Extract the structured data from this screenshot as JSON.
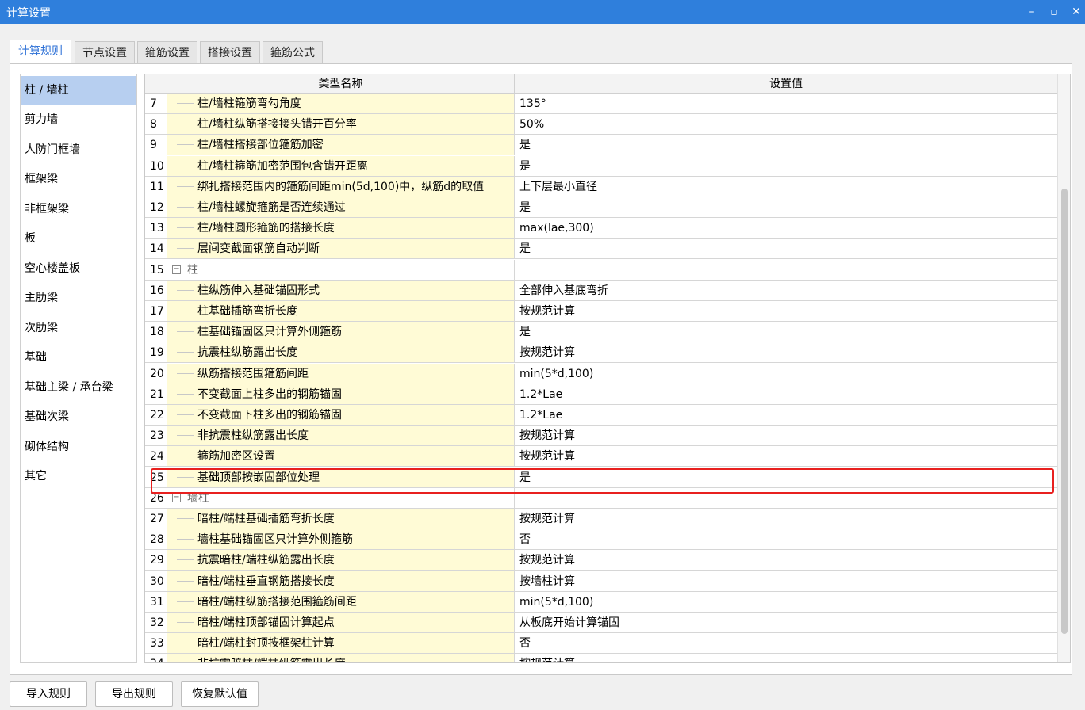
{
  "window": {
    "title": "计算设置",
    "minimize": "–",
    "maximize": "▫",
    "close": "✕"
  },
  "tabs": [
    "计算规则",
    "节点设置",
    "箍筋设置",
    "搭接设置",
    "箍筋公式"
  ],
  "sidebar": [
    "柱 / 墙柱",
    "剪力墙",
    "人防门框墙",
    "框架梁",
    "非框架梁",
    "板",
    "空心楼盖板",
    "主肋梁",
    "次肋梁",
    "基础",
    "基础主梁 / 承台梁",
    "基础次梁",
    "砌体结构",
    "其它"
  ],
  "grid": {
    "headers": [
      "类型名称",
      "设置值"
    ],
    "rows": [
      {
        "n": "7",
        "name": "柱/墙柱箍筋弯勾角度",
        "value": "135°"
      },
      {
        "n": "8",
        "name": "柱/墙柱纵筋搭接接头错开百分率",
        "value": "50%"
      },
      {
        "n": "9",
        "name": "柱/墙柱搭接部位箍筋加密",
        "value": "是"
      },
      {
        "n": "10",
        "name": "柱/墙柱箍筋加密范围包含错开距离",
        "value": "是"
      },
      {
        "n": "11",
        "name": "绑扎搭接范围内的箍筋间距min(5d,100)中，纵筋d的取值",
        "value": "上下层最小直径"
      },
      {
        "n": "12",
        "name": "柱/墙柱螺旋箍筋是否连续通过",
        "value": "是"
      },
      {
        "n": "13",
        "name": "柱/墙柱圆形箍筋的搭接长度",
        "value": "max(lae,300)"
      },
      {
        "n": "14",
        "name": "层间变截面钢筋自动判断",
        "value": "是"
      },
      {
        "n": "15",
        "group": "柱"
      },
      {
        "n": "16",
        "name": "柱纵筋伸入基础锚固形式",
        "value": "全部伸入基底弯折"
      },
      {
        "n": "17",
        "name": "柱基础插筋弯折长度",
        "value": "按规范计算"
      },
      {
        "n": "18",
        "name": "柱基础锚固区只计算外侧箍筋",
        "value": "是"
      },
      {
        "n": "19",
        "name": "抗震柱纵筋露出长度",
        "value": "按规范计算"
      },
      {
        "n": "20",
        "name": "纵筋搭接范围箍筋间距",
        "value": "min(5*d,100)"
      },
      {
        "n": "21",
        "name": "不变截面上柱多出的钢筋锚固",
        "value": "1.2*Lae"
      },
      {
        "n": "22",
        "name": "不变截面下柱多出的钢筋锚固",
        "value": "1.2*Lae"
      },
      {
        "n": "23",
        "name": "非抗震柱纵筋露出长度",
        "value": "按规范计算"
      },
      {
        "n": "24",
        "name": "箍筋加密区设置",
        "value": "按规范计算"
      },
      {
        "n": "25",
        "name": "基础顶部按嵌固部位处理",
        "value": "是"
      },
      {
        "n": "26",
        "group": "墙柱"
      },
      {
        "n": "27",
        "name": "暗柱/端柱基础插筋弯折长度",
        "value": "按规范计算"
      },
      {
        "n": "28",
        "name": "墙柱基础锚固区只计算外侧箍筋",
        "value": "否"
      },
      {
        "n": "29",
        "name": "抗震暗柱/端柱纵筋露出长度",
        "value": "按规范计算"
      },
      {
        "n": "30",
        "name": "暗柱/端柱垂直钢筋搭接长度",
        "value": "按墙柱计算"
      },
      {
        "n": "31",
        "name": "暗柱/端柱纵筋搭接范围箍筋间距",
        "value": "min(5*d,100)"
      },
      {
        "n": "32",
        "name": "暗柱/端柱顶部锚固计算起点",
        "value": "从板底开始计算锚固"
      },
      {
        "n": "33",
        "name": "暗柱/端柱封顶按框架柱计算",
        "value": "否"
      },
      {
        "n": "34",
        "name": "非抗震暗柱/端柱纵筋露出长度",
        "value": "按规范计算"
      }
    ]
  },
  "buttons": [
    "导入规则",
    "导出规则",
    "恢复默认值"
  ],
  "colors": {
    "titlebar": "#2f7fdc",
    "selected": "#b7cff0",
    "name_cell": "#fffbd6",
    "highlight": "#e8201f",
    "active_tab": "#2b6fd6"
  }
}
